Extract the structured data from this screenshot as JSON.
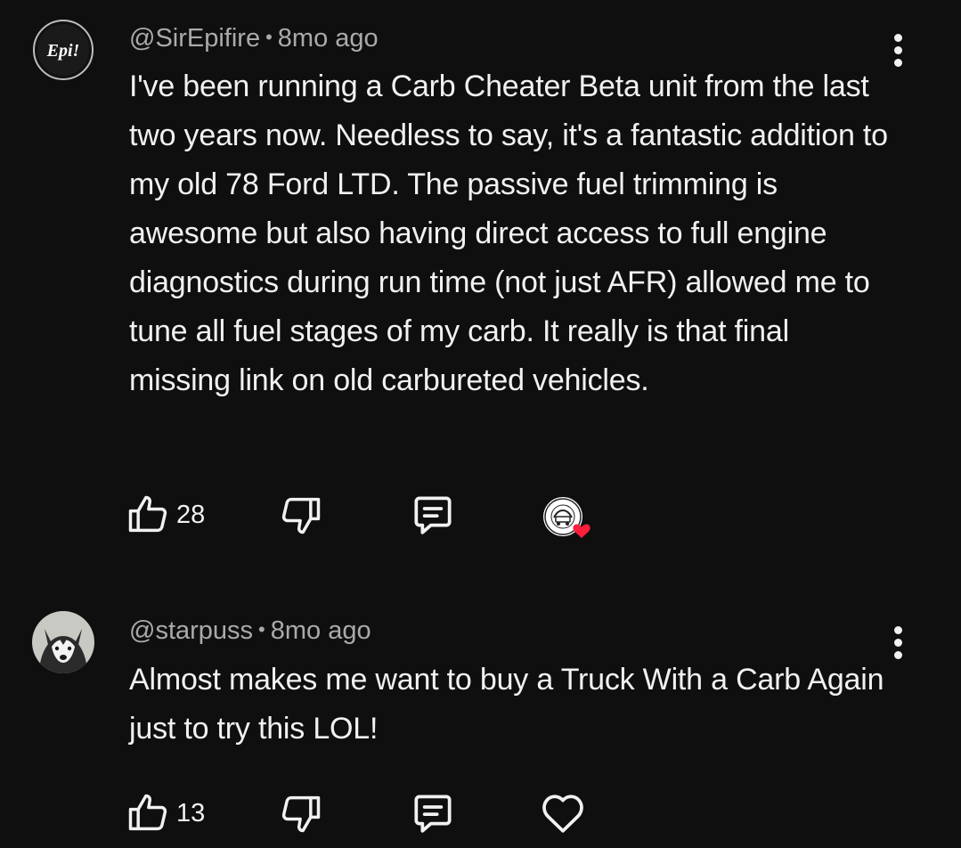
{
  "comments": [
    {
      "author": "@SirEpifire",
      "separator": "•",
      "time": "8mo ago",
      "avatar_text": "Epi!",
      "text": "I've been running a Carb Cheater Beta unit from the last two years now. Needless to say, it's a fantastic addition to my old 78 Ford LTD. The passive fuel trimming is awesome but also having direct access to full engine diagnostics during run time (not just AFR) allowed me to tune all fuel stages of my carb. It really is that final missing link on old carbureted vehicles.",
      "like_count": "28",
      "creator_hearted": true,
      "heart_color": "#ff1f3d"
    },
    {
      "author": "@starpuss",
      "separator": "•",
      "time": "8mo ago",
      "text": "Almost makes me want to buy a Truck With a Carb Again just to try this LOL!",
      "like_count": "13",
      "creator_hearted": false
    }
  ],
  "icons": {
    "like": "thumbs-up-icon",
    "dislike": "thumbs-down-icon",
    "reply": "reply-icon",
    "heart": "heart-icon",
    "more": "more-vertical-icon"
  },
  "colors": {
    "background": "#0f0f0f",
    "text_primary": "#f1f1f1",
    "text_secondary": "#aaaaaa"
  }
}
